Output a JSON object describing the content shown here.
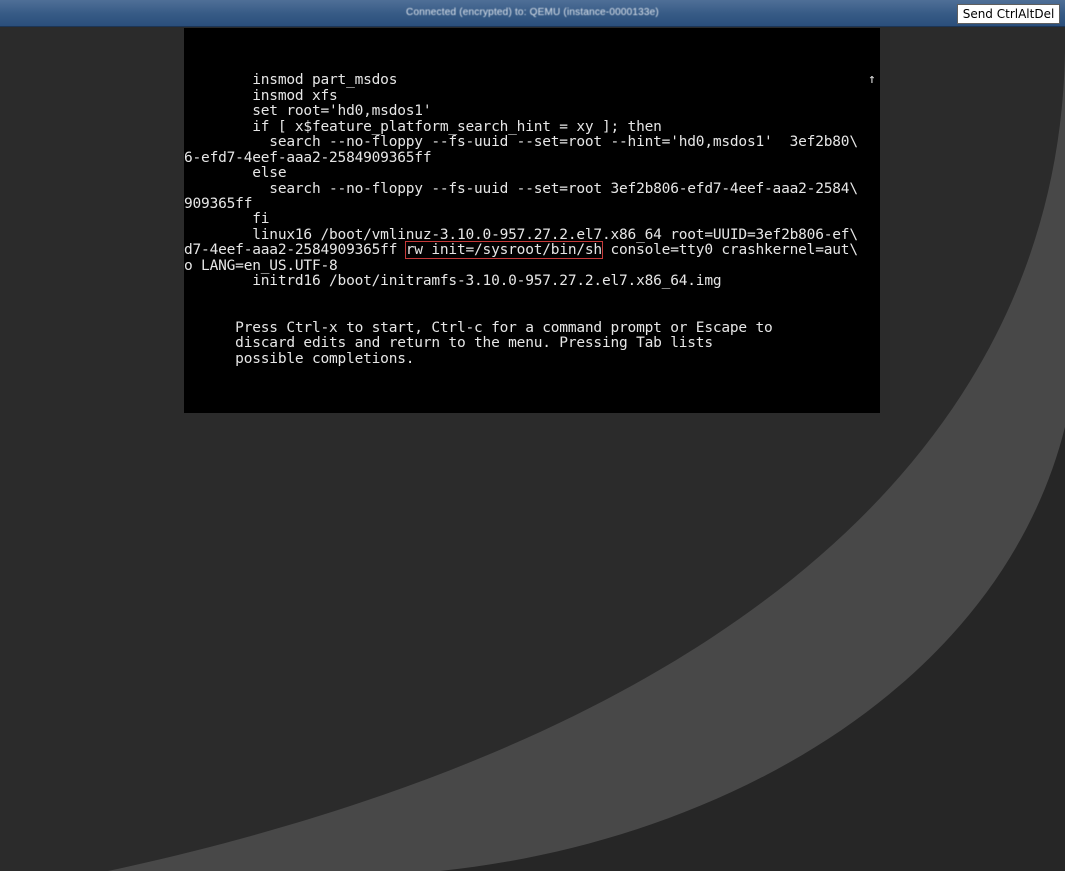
{
  "window": {
    "status_text": "Connected (encrypted) to: QEMU (instance-0000133e)",
    "ctrl_alt_del_label": "Send CtrlAltDel"
  },
  "console": {
    "scroll_indicator": "↑",
    "lines": {
      "l1": "        insmod part_msdos",
      "l2": "        insmod xfs",
      "l3": "        set root='hd0,msdos1'",
      "l4": "        if [ x$feature_platform_search_hint = xy ]; then",
      "l5": "          search --no-floppy --fs-uuid --set=root --hint='hd0,msdos1'  3ef2b80\\",
      "l6": "6-efd7-4eef-aaa2-2584909365ff",
      "l7": "        else",
      "l8": "          search --no-floppy --fs-uuid --set=root 3ef2b806-efd7-4eef-aaa2-2584\\",
      "l9": "909365ff",
      "l10": "        fi",
      "l11": "        linux16 /boot/vmlinuz-3.10.0-957.27.2.el7.x86_64 root=UUID=3ef2b806-ef\\",
      "l12_pre": "d7-4eef-aaa2-2584909365ff ",
      "l12_hl": "rw init=/sysroot/bin/sh",
      "l12_post": " console=tty0 crashkernel=aut\\",
      "l13": "o LANG=en_US.UTF-8",
      "l14": "        initrd16 /boot/initramfs-3.10.0-957.27.2.el7.x86_64.img",
      "l15": "      Press Ctrl-x to start, Ctrl-c for a command prompt or Escape to",
      "l16": "      discard edits and return to the menu. Pressing Tab lists",
      "l17": "      possible completions."
    }
  },
  "colors": {
    "background": "#2b2b2b",
    "swoosh_light": "#484848",
    "swoosh_dark": "#262626",
    "titlebar": "#365a85",
    "console_bg": "#000000",
    "console_text": "#e6e6e6",
    "highlight_box": "#c53a3a"
  }
}
